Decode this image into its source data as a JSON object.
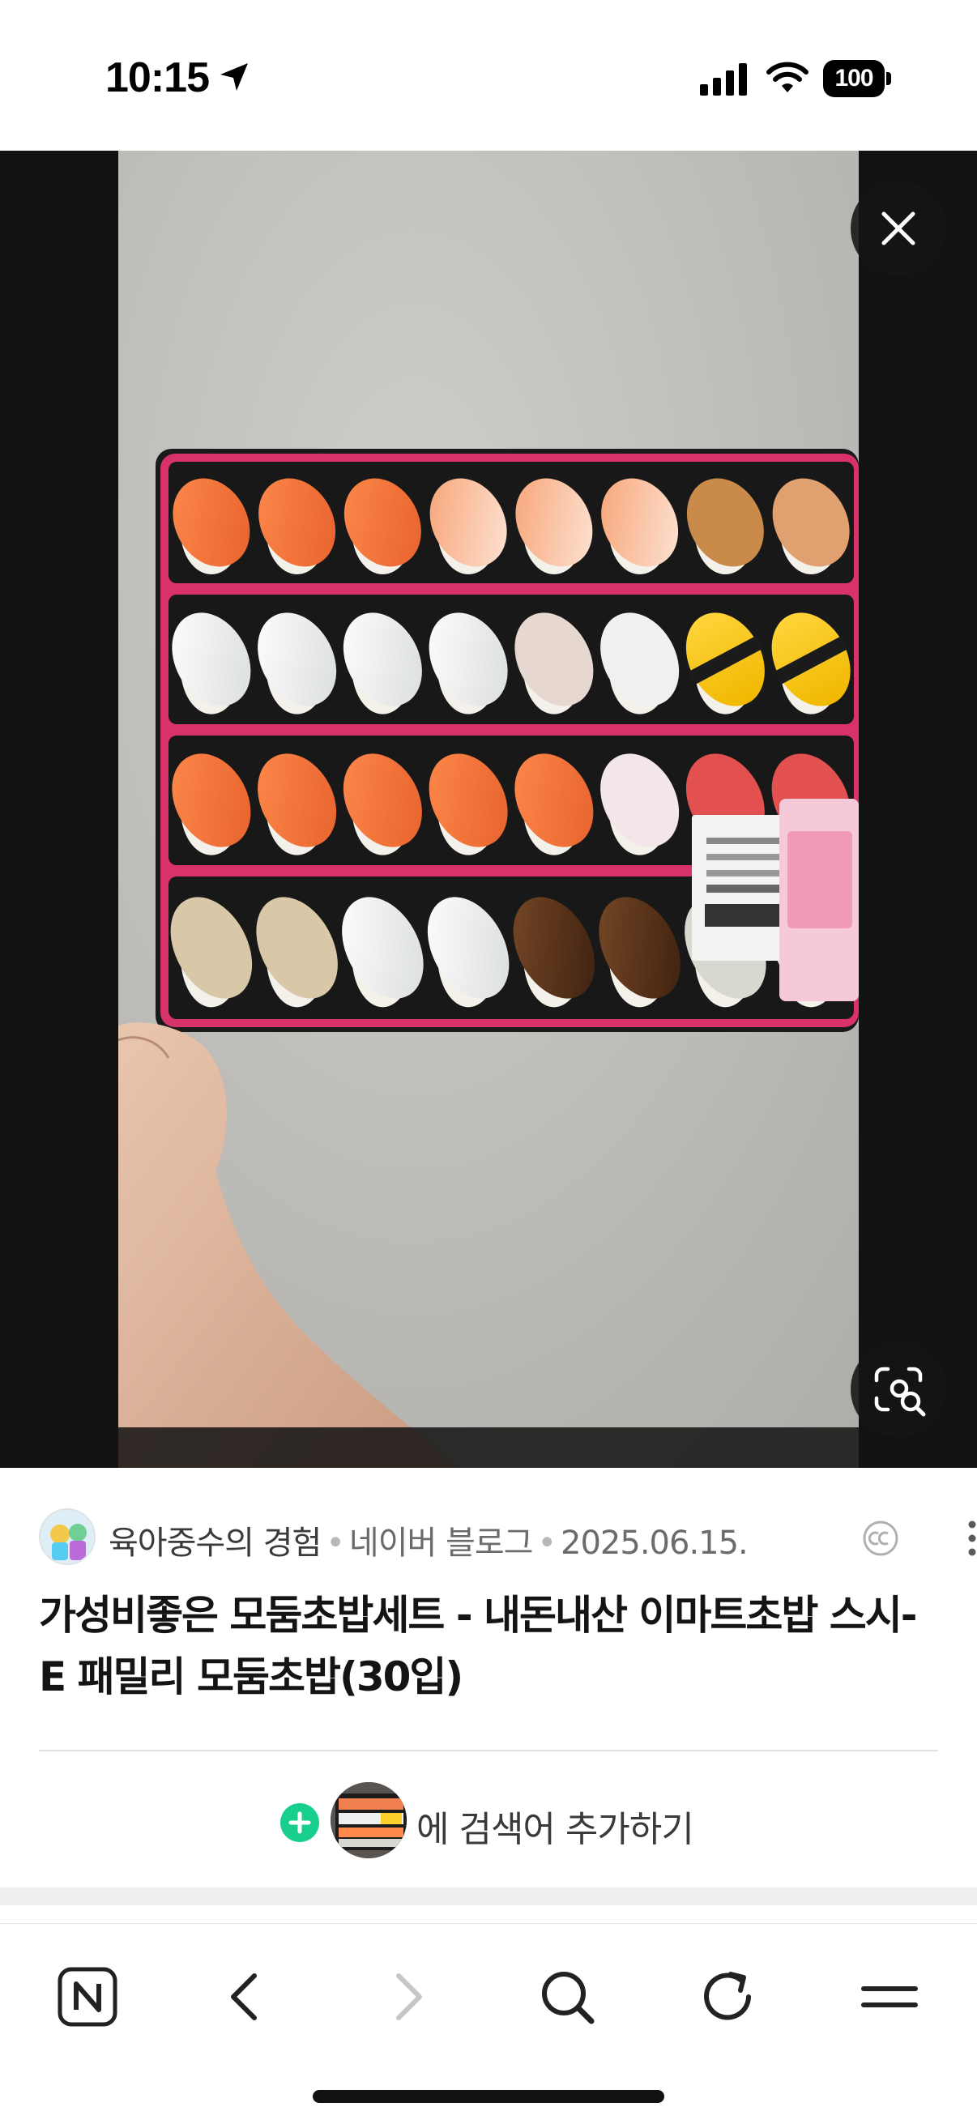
{
  "status_bar": {
    "time": "10:15",
    "battery": "100",
    "icons": [
      "location-arrow-icon",
      "cellular-signal-icon",
      "wifi-icon",
      "battery-icon"
    ]
  },
  "viewer": {
    "image_subject": "사진",
    "controls": [
      "close-icon",
      "lens-search-icon"
    ]
  },
  "result": {
    "blogger": "육아중수의 경험",
    "platform": "네이버 블로그",
    "date": "2025.06.15.",
    "separator": "•",
    "license_icon": "cc-icon",
    "title": "가성비좋은 모둠초밥세트 - 내돈내산 이마트초밥 스시-E 패밀리 모둠초밥(30입)"
  },
  "add_search": {
    "label": "에 검색어 추가하기"
  },
  "toolbar": {
    "buttons": [
      "naver-home-icon",
      "back-icon",
      "forward-icon",
      "search-icon",
      "reload-icon",
      "menu-icon"
    ]
  },
  "colors": {
    "accent_green": "#19cf8d",
    "viewer_bg": "#121212",
    "tray_pink": "#d8326a"
  }
}
